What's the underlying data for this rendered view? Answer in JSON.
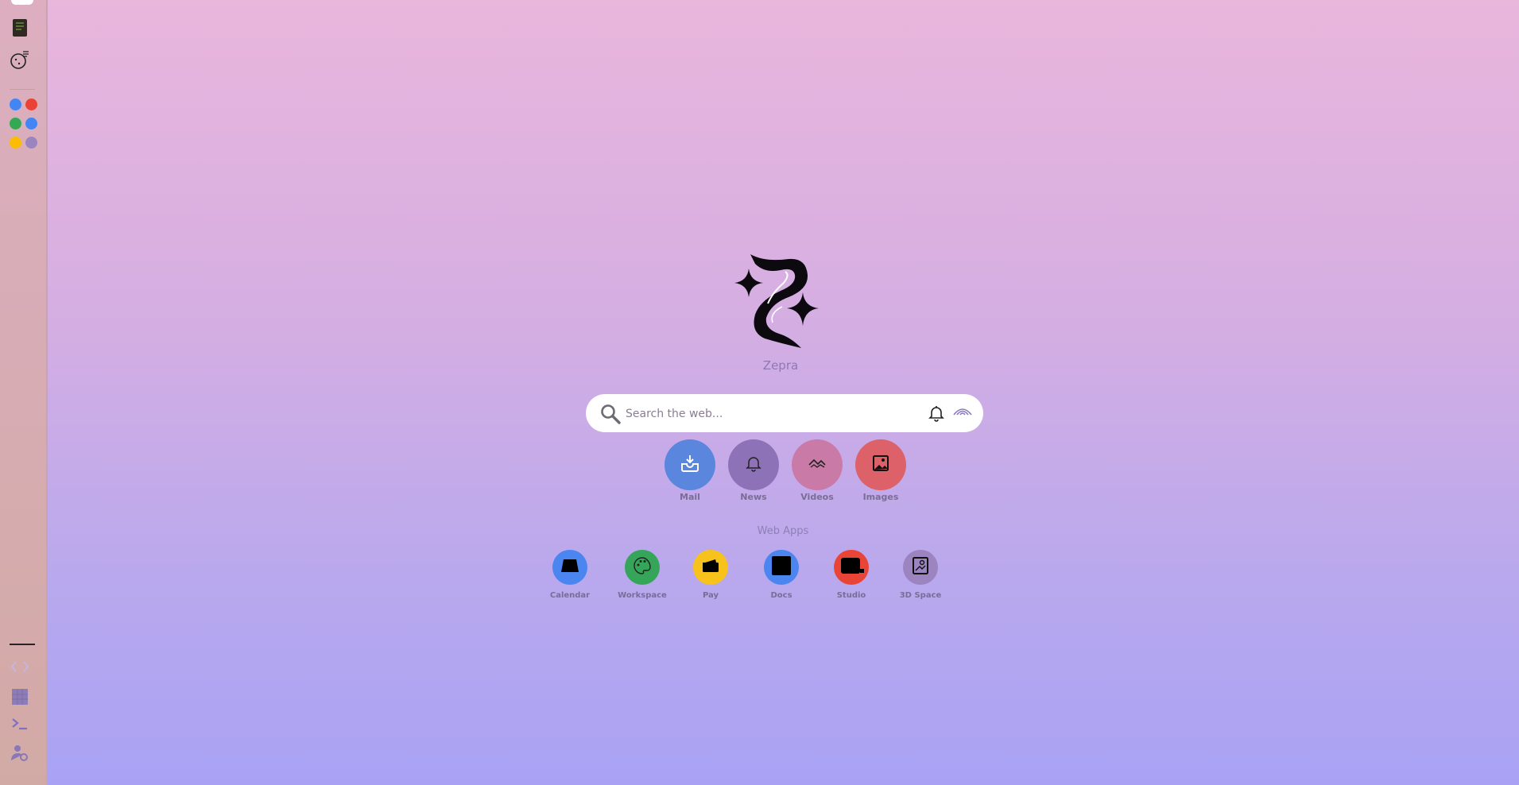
{
  "brand": {
    "name": "Zepra"
  },
  "search": {
    "placeholder": "Search the web..."
  },
  "quick_actions": [
    {
      "label": "Mail",
      "color": "#5a86dd",
      "icon": "inbox-download-icon"
    },
    {
      "label": "News",
      "color": "#8e72b8",
      "icon": "bell-icon"
    },
    {
      "label": "Videos",
      "color": "#c97aa6",
      "icon": "film-icon"
    },
    {
      "label": "Images",
      "color": "#dc6168",
      "icon": "image-icon"
    }
  ],
  "web_apps_title": "Web Apps",
  "web_apps": [
    {
      "label": "Calendar",
      "color": "#4a85f0",
      "icon": "calendar-icon"
    },
    {
      "label": "Workspace",
      "color": "#35a55a",
      "icon": "palette-icon"
    },
    {
      "label": "Pay",
      "color": "#f7c21b",
      "icon": "wallet-icon"
    },
    {
      "label": "Docs",
      "color": "#4a85f0",
      "icon": "document-icon"
    },
    {
      "label": "Studio",
      "color": "#e94435",
      "icon": "video-camera-icon"
    },
    {
      "label": "3D Space",
      "color": "#9b84bf",
      "icon": "cube-frame-icon"
    }
  ],
  "sidebar": {
    "color_dots": [
      "#4285f4",
      "#ea4335",
      "#34a853",
      "#4285f4",
      "#fbbc05",
      "#9b84bf"
    ],
    "top_icons": [
      "terminal-book-icon",
      "cookie-icon"
    ],
    "bottom_icons": [
      "code-icon",
      "grid-icon",
      "terminal-icon",
      "user-settings-icon"
    ]
  }
}
